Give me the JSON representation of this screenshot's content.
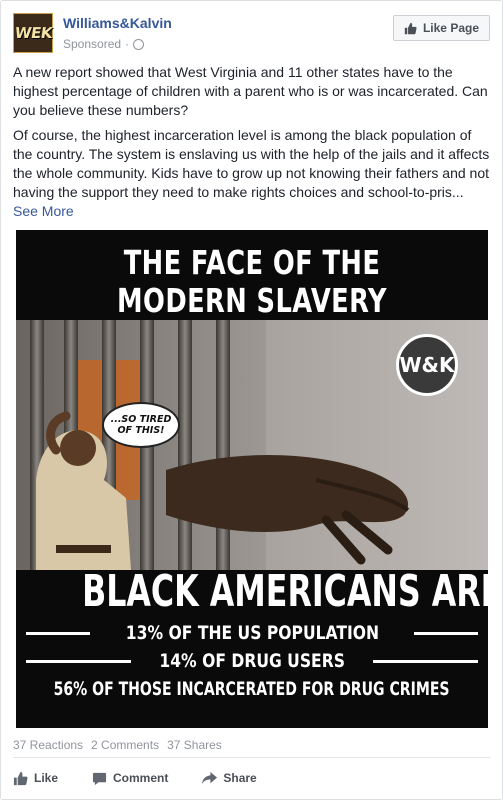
{
  "post": {
    "page_name": "Williams&Kalvin",
    "avatar_text": "WEK",
    "sponsored_label": "Sponsored",
    "separator": "·",
    "like_page_label": "Like Page",
    "paragraph1": "A new report showed that West Virginia and 11 other states have to the highest percentage of children with a parent who is or was incarcerated. Can you believe these numbers?",
    "paragraph2": "Of course, the highest incarceration level is among the black population of the country. The system is enslaving us with the help of the jails and it affects the whole community. Kids have to grow up not knowing their fathers and not having the support they need to make rights choices and school-to-pris...",
    "see_more_label": "See More"
  },
  "image": {
    "headline_line1": "THE FACE OF THE",
    "headline_line2": "MODERN SLAVERY",
    "logo_text": "W&K",
    "bubble_line1": "...SO TIRED",
    "bubble_line2": "OF THIS!",
    "bottom_title": "BLACK AMERICANS ARE",
    "stat1": "13% OF THE US POPULATION",
    "stat2": "14% OF DRUG USERS",
    "stat3": "56% OF THOSE INCARCERATED FOR DRUG CRIMES"
  },
  "engagement": {
    "reactions": "37 Reactions",
    "comments": "2 Comments",
    "shares": "37 Shares"
  },
  "actions": {
    "like": "Like",
    "comment": "Comment",
    "share": "Share"
  },
  "icons": {
    "avatar": "page-avatar-icon",
    "globe": "globe-icon",
    "like_page": "thumbs-up-icon",
    "like": "thumbs-up-icon",
    "comment": "comment-icon",
    "share": "share-arrow-icon"
  },
  "colors": {
    "link": "#365899",
    "text": "#1d2129",
    "muted": "#90949c",
    "action": "#4b4f56"
  }
}
